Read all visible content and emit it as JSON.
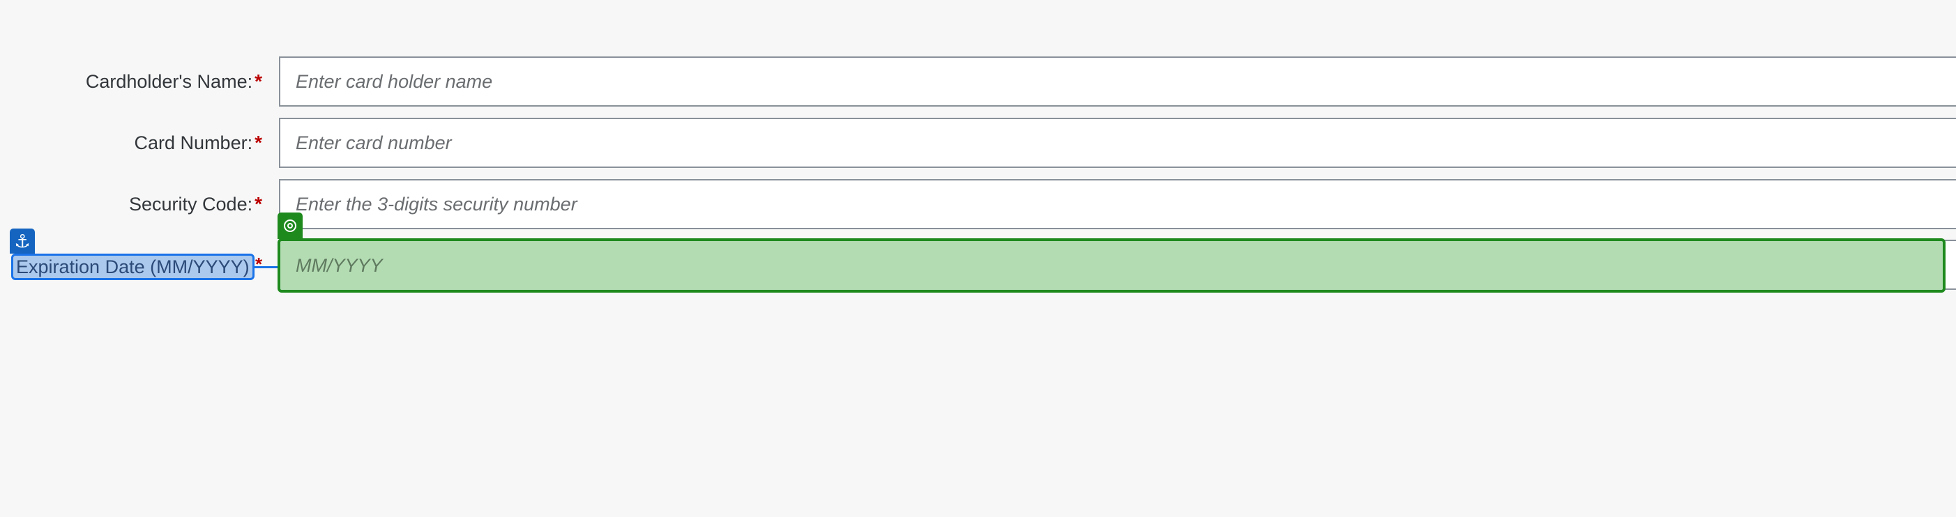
{
  "form": {
    "cardholder_name": {
      "label": "Cardholder's Name:",
      "required_mark": "*",
      "placeholder": "Enter card holder name",
      "value": ""
    },
    "card_number": {
      "label": "Card Number:",
      "required_mark": "*",
      "placeholder": "Enter card number",
      "value": ""
    },
    "security_code": {
      "label": "Security Code:",
      "required_mark": "*",
      "placeholder": "Enter the 3-digits security number",
      "value": ""
    },
    "expiration_date": {
      "label": "Expiration Date (MM/YYYY)",
      "required_mark": "*",
      "placeholder": "MM/YYYY",
      "value": ""
    }
  },
  "overlay": {
    "anchor_icon": "anchor-icon",
    "target_icon": "target-icon",
    "anchor_color": "#1565c0",
    "target_color": "#1e8a1e"
  }
}
